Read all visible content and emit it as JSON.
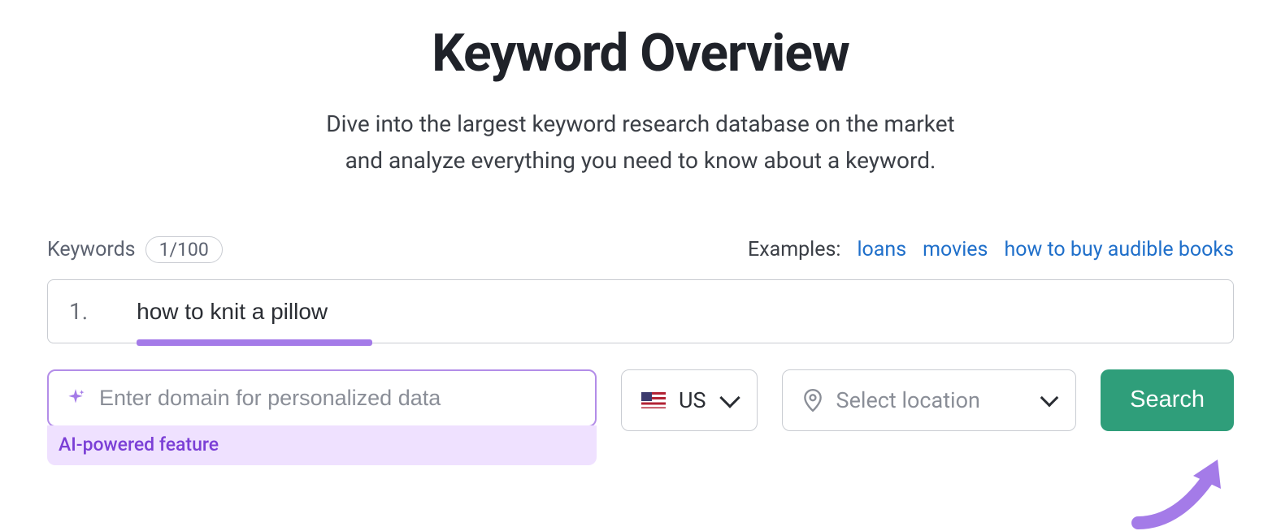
{
  "header": {
    "title": "Keyword Overview",
    "subtitle_line1": "Dive into the largest keyword research database on the market",
    "subtitle_line2": "and analyze everything you need to know about a keyword."
  },
  "keywords": {
    "label": "Keywords",
    "count": "1/100",
    "num_prefix": "1.",
    "value": "how to knit a pillow"
  },
  "examples": {
    "label": "Examples:",
    "items": [
      "loans",
      "movies",
      "how to buy audible books"
    ]
  },
  "domain": {
    "placeholder": "Enter domain for personalized data",
    "ai_badge": "AI-powered feature"
  },
  "country": {
    "code": "US"
  },
  "location": {
    "placeholder": "Select location"
  },
  "buttons": {
    "search": "Search"
  },
  "colors": {
    "accent_green": "#2f9e7a",
    "accent_purple": "#a47be8",
    "link_blue": "#1f6fca"
  }
}
